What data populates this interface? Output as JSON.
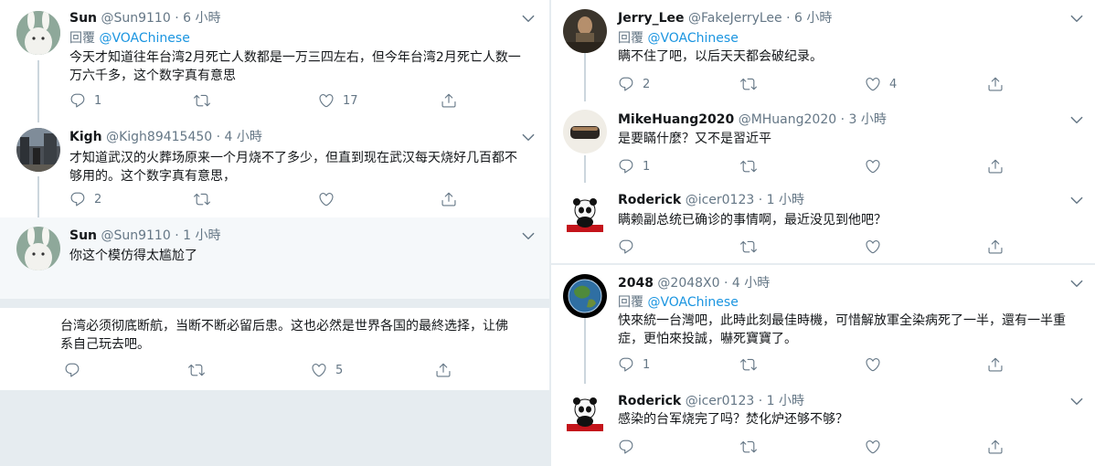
{
  "reply_prefix": "回覆",
  "left": {
    "tweets": [
      {
        "name": "Sun",
        "handle": "@Sun9110",
        "sep": "·",
        "time": "6 小時",
        "reply_to": "@VOAChinese",
        "text": "今天才知道往年台湾2月死亡人数都是一万三四左右，但今年台湾2月死亡人数一万六千多，这个数字真有意思",
        "reply_count": "1",
        "retweet_count": "",
        "like_count": "17"
      },
      {
        "name": "Kigh",
        "handle": "@Kigh89415450",
        "sep": "·",
        "time": "4 小時",
        "text": "才知道武汉的火葬场原来一个月烧不了多少，但直到现在武汉每天烧好几百都不够用的。这个数字真有意思，",
        "reply_count": "2",
        "retweet_count": "",
        "like_count": ""
      },
      {
        "name": "Sun",
        "handle": "@Sun9110",
        "sep": "·",
        "time": "1 小時",
        "text": "你这个模仿得太尴尬了",
        "reply_count": "",
        "retweet_count": "",
        "like_count": ""
      },
      {
        "text": "台湾必须彻底断航，当断不断必留后患。这也必然是世界各国的最終选择，让佛系自己玩去吧。",
        "reply_count": "",
        "retweet_count": "",
        "like_count": "5"
      }
    ]
  },
  "right": {
    "tweets": [
      {
        "name": "Jerry_Lee",
        "handle": "@FakeJerryLee",
        "sep": "·",
        "time": "6 小時",
        "reply_to": "@VOAChinese",
        "text": "瞒不住了吧，以后天天都会破纪录。",
        "reply_count": "2",
        "retweet_count": "",
        "like_count": "4"
      },
      {
        "name": "MikeHuang2020",
        "handle": "@MHuang2020",
        "sep": "·",
        "time": "3 小時",
        "text": "是要瞞什麼？又不是習近平",
        "reply_count": "1",
        "retweet_count": "",
        "like_count": ""
      },
      {
        "name": "Roderick",
        "handle": "@icer0123",
        "sep": "·",
        "time": "1 小時",
        "text": "瞒赖副总统已确诊的事情啊，最近没见到他吧？",
        "reply_count": "",
        "retweet_count": "",
        "like_count": ""
      },
      {
        "name": "2048",
        "handle": "@2048X0",
        "sep": "·",
        "time": "4 小時",
        "reply_to": "@VOAChinese",
        "text": "快來統一台灣吧，此時此刻最佳時機，可惜解放軍全染病死了一半，還有一半重症，更怕來投誠，嚇死寶寶了。",
        "reply_count": "1",
        "retweet_count": "",
        "like_count": ""
      },
      {
        "name": "Roderick",
        "handle": "@icer0123",
        "sep": "·",
        "time": "1 小時",
        "text": "感染的台军烧完了吗？焚化炉还够不够？",
        "reply_count": "",
        "retweet_count": "",
        "like_count": ""
      }
    ]
  },
  "colors": {
    "link": "#1b95e0",
    "muted": "#657786",
    "text": "#14171a",
    "divider": "#e6ecf0",
    "highlight": "#f5f8fa"
  },
  "icons": [
    "chevron-down-icon",
    "reply-icon",
    "retweet-icon",
    "like-icon",
    "share-icon"
  ]
}
